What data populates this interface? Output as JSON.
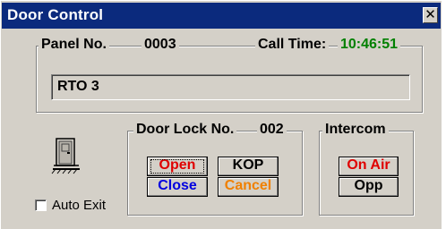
{
  "window": {
    "title": "Door Control",
    "close_glyph": "✕"
  },
  "panel": {
    "label": "Panel No.",
    "value": "0003",
    "call_time_label": "Call Time:",
    "call_time": "10:46:51"
  },
  "station_name": "RTO 3",
  "door_lock": {
    "label": "Door Lock No.",
    "value": "002",
    "buttons": {
      "open": "Open",
      "kop": "KOP",
      "close": "Close",
      "cancel": "Cancel"
    }
  },
  "intercom": {
    "label": "Intercom",
    "buttons": {
      "on_air": "On Air",
      "opp": "Opp"
    }
  },
  "auto_exit": {
    "label": "Auto Exit",
    "checked": false
  },
  "colors": {
    "title_bar": "#0b2a7d",
    "call_time": "#008000",
    "open": "#e00000",
    "close": "#0000e0",
    "cancel": "#f08000",
    "on_air": "#e00000"
  },
  "icons": {
    "door": "door-icon"
  }
}
